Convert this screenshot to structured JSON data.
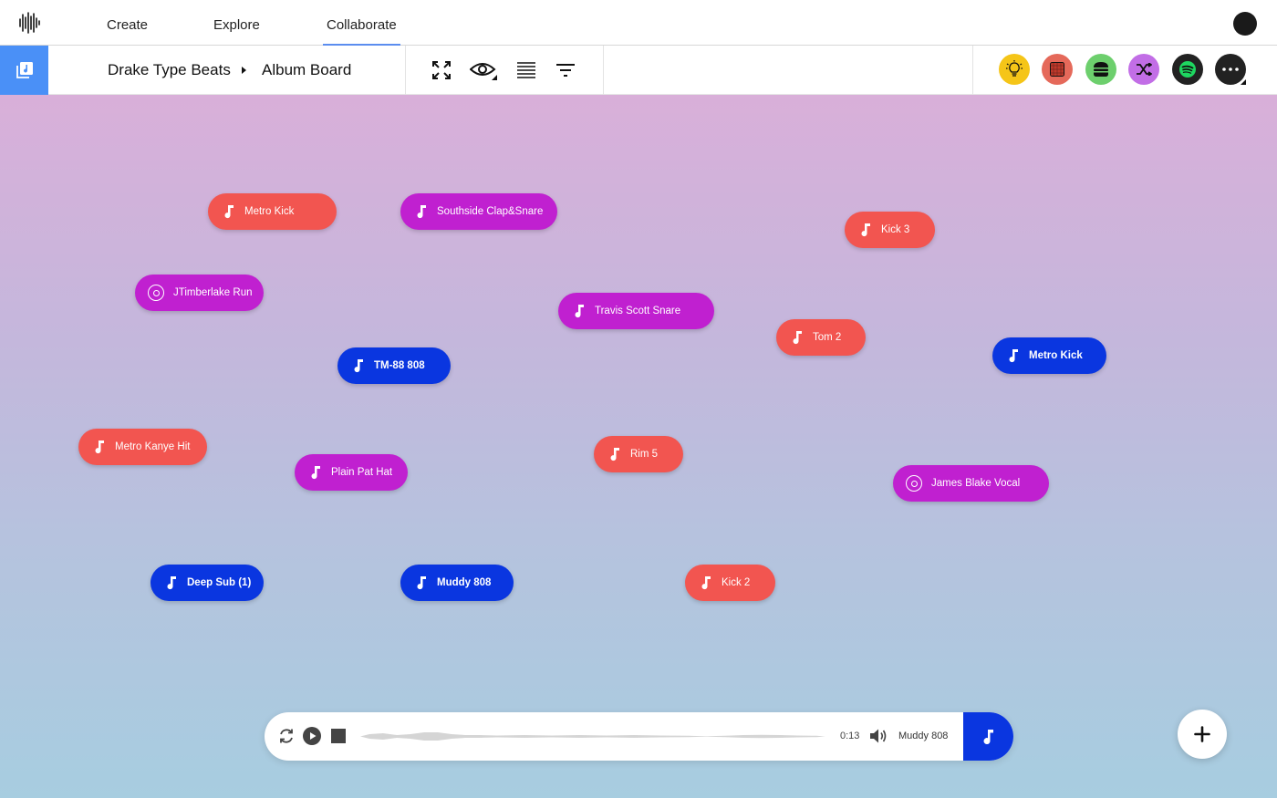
{
  "nav": {
    "items": [
      {
        "label": "Create"
      },
      {
        "label": "Explore"
      },
      {
        "label": "Collaborate",
        "active": true
      }
    ]
  },
  "breadcrumb": {
    "project": "Drake Type Beats",
    "board": "Album Board"
  },
  "toolbar": {
    "tools": [
      "fullscreen-icon",
      "eye-icon",
      "list-icon",
      "filter-icon"
    ]
  },
  "integrations": [
    {
      "name": "lightbulb-icon",
      "color": "#f5c518"
    },
    {
      "name": "drum-pad-icon",
      "color": "#e5695a"
    },
    {
      "name": "burger-icon",
      "color": "#6dcf6d"
    },
    {
      "name": "shuffle-icon",
      "color": "#c26ee6"
    },
    {
      "name": "spotify-icon",
      "color": "#222222"
    },
    {
      "name": "more-icon",
      "color": "#222222"
    }
  ],
  "colors": {
    "red": "#f25550",
    "purple": "#c020d0",
    "blue": "#0a36e0",
    "accent": "#4a90f7"
  },
  "sounds": [
    {
      "label": "Metro Kick",
      "color": "red",
      "icon": "note"
    },
    {
      "label": "Southside Clap&Snare",
      "color": "purple",
      "icon": "note"
    },
    {
      "label": "Kick 3",
      "color": "red",
      "icon": "note"
    },
    {
      "label": "JTimberlake Run",
      "color": "purple",
      "icon": "vinyl"
    },
    {
      "label": "Travis Scott Snare",
      "color": "purple",
      "icon": "note"
    },
    {
      "label": "Tom 2",
      "color": "red",
      "icon": "note"
    },
    {
      "label": "TM-88 808",
      "color": "blue",
      "icon": "note"
    },
    {
      "label": "Metro Kick",
      "color": "blue",
      "icon": "note"
    },
    {
      "label": "Metro Kanye Hit",
      "color": "red",
      "icon": "note"
    },
    {
      "label": "Plain Pat Hat",
      "color": "purple",
      "icon": "note"
    },
    {
      "label": "Rim 5",
      "color": "red",
      "icon": "note"
    },
    {
      "label": "James Blake Vocal",
      "color": "purple",
      "icon": "vinyl"
    },
    {
      "label": "Deep Sub (1)",
      "color": "blue",
      "icon": "note"
    },
    {
      "label": "Muddy 808",
      "color": "blue",
      "icon": "note"
    },
    {
      "label": "Kick 2",
      "color": "red",
      "icon": "note"
    }
  ],
  "player": {
    "time": "0:13",
    "track": "Muddy 808"
  }
}
